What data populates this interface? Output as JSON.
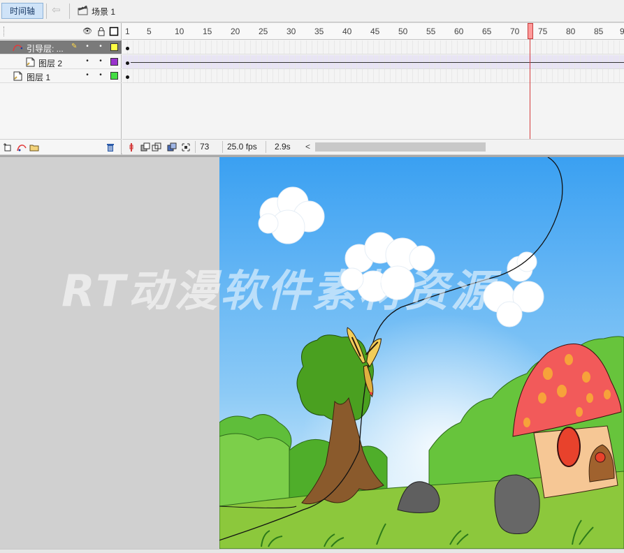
{
  "toolbar": {
    "timeline_label": "时间轴",
    "scene_label": "场景 1"
  },
  "layers": [
    {
      "name": "引导层: ...",
      "type": "guide",
      "color": "#ffff44",
      "selected": true
    },
    {
      "name": "图层 2",
      "type": "guided",
      "color": "#9933cc",
      "selected": false
    },
    {
      "name": "图层 1",
      "type": "normal",
      "color": "#44dd44",
      "selected": false
    }
  ],
  "ruler": {
    "labels": [
      "1",
      "5",
      "10",
      "15",
      "20",
      "25",
      "30",
      "35",
      "40",
      "45",
      "50",
      "55",
      "60",
      "65",
      "70",
      "75",
      "80",
      "85",
      "9"
    ],
    "current_frame_marker": 73
  },
  "status": {
    "frame": "73",
    "fps": "25.0 fps",
    "time": "2.9s"
  },
  "watermark": "RT动漫软件素材资源",
  "colors": {
    "sky_top": "#3aa0f2",
    "sky_bottom": "#d8eefc",
    "grass": "#8cc83c",
    "mushroom_cap": "#f25a5a",
    "playhead": "#d43a3a"
  }
}
